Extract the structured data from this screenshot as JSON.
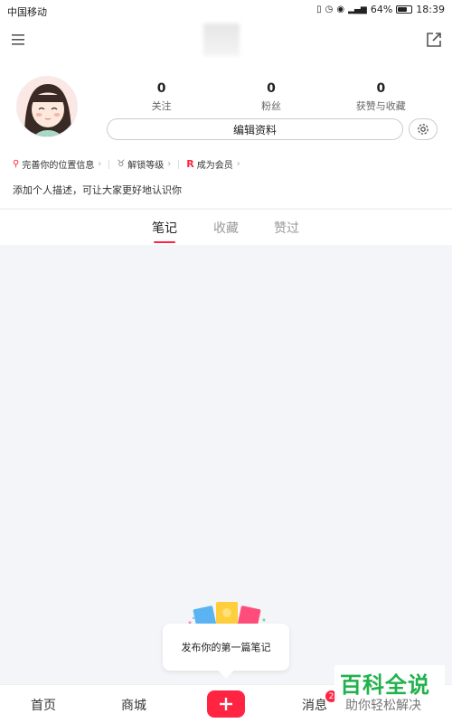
{
  "status_bar": {
    "carrier": "中国移动",
    "battery": "64%",
    "time": "18:39"
  },
  "profile": {
    "stats": [
      {
        "value": "0",
        "label": "关注"
      },
      {
        "value": "0",
        "label": "粉丝"
      },
      {
        "value": "0",
        "label": "获赞与收藏"
      }
    ],
    "edit_label": "编辑资料",
    "chips": [
      {
        "label": "完善你的位置信息"
      },
      {
        "label": "解锁等级"
      },
      {
        "label": "成为会员"
      }
    ],
    "description": "添加个人描述，可让大家更好地认识你"
  },
  "tabs": [
    "笔记",
    "收藏",
    "赞过"
  ],
  "empty_state": {
    "text": "发布你的第一篇笔记"
  },
  "bottom_nav": {
    "home": "首页",
    "mall": "商城",
    "messages": "消息",
    "badge": "2"
  },
  "watermark": {
    "line1": "百科全说",
    "line2": "助你轻松解决"
  },
  "colors": {
    "accent": "#ff2442",
    "watermark": "#22b14c"
  }
}
